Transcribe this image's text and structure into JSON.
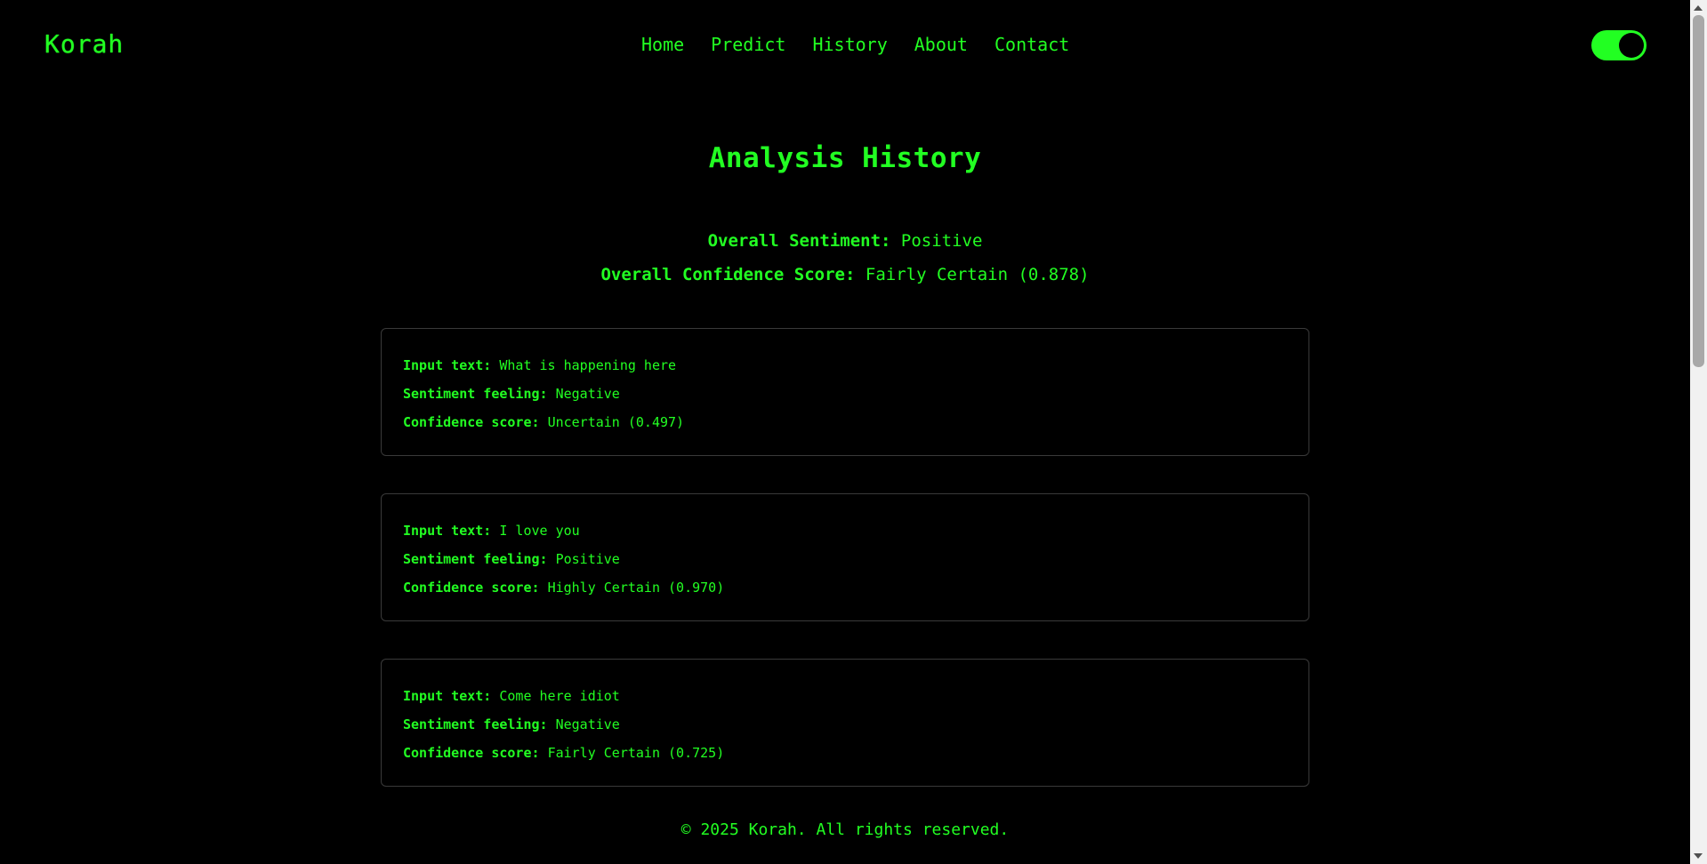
{
  "header": {
    "logo": "Korah",
    "nav": [
      "Home",
      "Predict",
      "History",
      "About",
      "Contact"
    ],
    "theme_toggle_on": true
  },
  "main": {
    "title": "Analysis History",
    "overall_sentiment_label": "Overall Sentiment:",
    "overall_sentiment_value": "Positive",
    "overall_confidence_label": "Overall Confidence Score:",
    "overall_confidence_value": "Fairly Certain (0.878)",
    "entries": [
      {
        "input_label": "Input text:",
        "input_value": "What is happening here",
        "sentiment_label": "Sentiment feeling:",
        "sentiment_value": "Negative",
        "confidence_label": "Confidence score:",
        "confidence_value": "Uncertain (0.497)"
      },
      {
        "input_label": "Input text:",
        "input_value": "I love you",
        "sentiment_label": "Sentiment feeling:",
        "sentiment_value": "Positive",
        "confidence_label": "Confidence score:",
        "confidence_value": "Highly Certain (0.970)"
      },
      {
        "input_label": "Input text:",
        "input_value": "Come here idiot",
        "sentiment_label": "Sentiment feeling:",
        "sentiment_value": "Negative",
        "confidence_label": "Confidence score:",
        "confidence_value": "Fairly Certain (0.725)"
      }
    ]
  },
  "footer": {
    "text": "© 2025 Korah. All rights reserved."
  },
  "colors": {
    "background": "#000000",
    "accent": "#22ff22",
    "card_border": "#3a3a3a"
  }
}
